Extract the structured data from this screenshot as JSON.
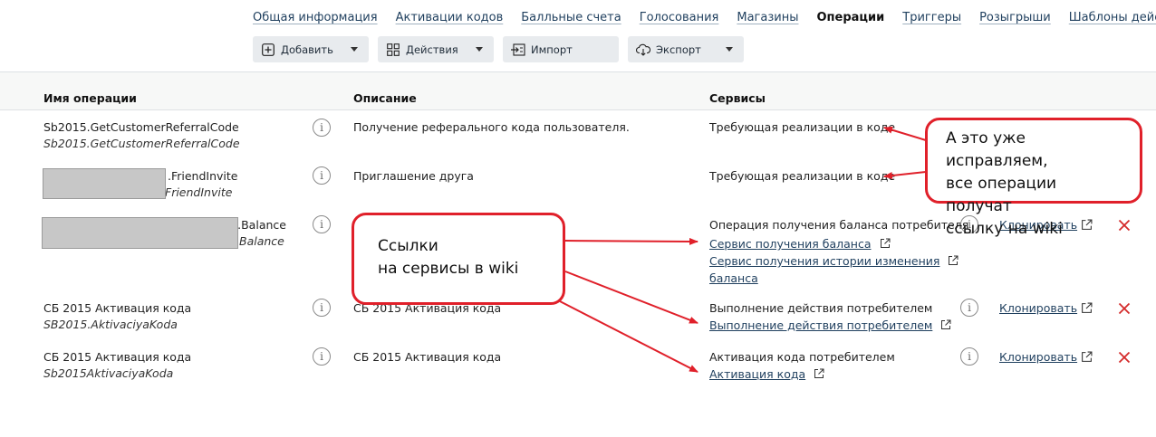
{
  "nav": {
    "tabs": [
      "Общая информация",
      "Активации кодов",
      "Балльные счета",
      "Голосования",
      "Магазины",
      "Операции",
      "Триггеры",
      "Розыгрыши",
      "Шаблоны действий"
    ],
    "active": "Операции"
  },
  "toolbar": {
    "add": "Добавить",
    "actions": "Действия",
    "import": "Импорт",
    "export": "Экспорт"
  },
  "table": {
    "columns": {
      "name": "Имя операции",
      "description": "Описание",
      "services": "Сервисы"
    },
    "rows": [
      {
        "name": "Sb2015.GetCustomerReferralCode",
        "system_name": "Sb2015.GetCustomerReferralCode",
        "description": "Получение реферального кода пользователя.",
        "service": "Требующая реализации в коде"
      },
      {
        "name": ".FriendInvite",
        "system_name": "FriendInvite",
        "description": "Приглашение друга",
        "service": "Требующая реализации в коде"
      },
      {
        "name": "ai.Balance",
        "system_name": "Balance",
        "description": "",
        "service": "Операция получения баланса потребителя",
        "links": [
          "Сервис получения баланса",
          "Сервис получения истории изменения",
          "баланса"
        ],
        "clone": "Клонировать"
      },
      {
        "name": "СБ 2015 Активация кода",
        "system_name": "SB2015.AktivaciyaKoda",
        "description": "СБ 2015 Активация кода",
        "service": "Выполнение действия потребителем",
        "links": [
          "Выполнение действия потребителем"
        ],
        "clone": "Клонировать"
      },
      {
        "name": "СБ 2015 Активация кода",
        "system_name": "Sb2015AktivaciyaKoda",
        "description": "СБ 2015 Активация кода",
        "service": "Активация кода потребителем",
        "links": [
          "Активация кода"
        ],
        "clone": "Клонировать"
      }
    ]
  },
  "annotations": {
    "callout_right": [
      "А это уже исправляем,",
      "все операции получат",
      "ссылку на wiki"
    ],
    "callout_left": [
      "Ссылки",
      "на сервисы в wiki"
    ]
  },
  "colors": {
    "accent_red": "#e0202a",
    "link": "#1f3f5e",
    "toolbar_bg": "#e8ebee"
  }
}
